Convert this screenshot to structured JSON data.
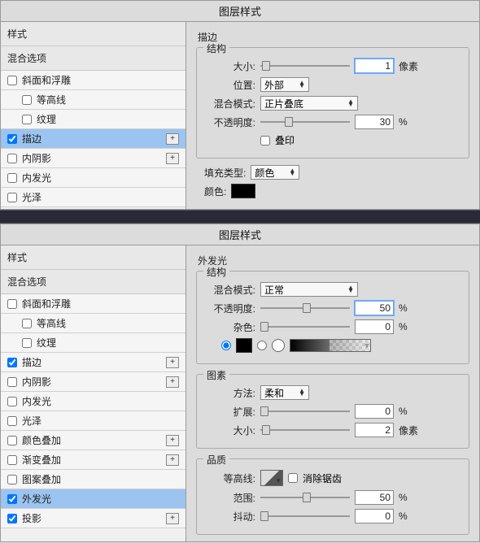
{
  "panel1": {
    "title": "图层样式",
    "sidebar": {
      "header1": "样式",
      "header2": "混合选项",
      "items": [
        {
          "label": "斜面和浮雕",
          "cb": false,
          "plus": false
        },
        {
          "label": "等高线",
          "cb": false,
          "plus": false,
          "indent": true
        },
        {
          "label": "纹理",
          "cb": false,
          "plus": false,
          "indent": true
        },
        {
          "label": "描边",
          "cb": true,
          "plus": true,
          "selected": true
        },
        {
          "label": "内阴影",
          "cb": false,
          "plus": true
        },
        {
          "label": "内发光",
          "cb": false,
          "plus": false
        },
        {
          "label": "光泽",
          "cb": false,
          "plus": false
        }
      ]
    },
    "content": {
      "sectionTitle": "描边",
      "structTitle": "结构",
      "sizeLabel": "大小:",
      "sizeValue": "1",
      "sizeUnit": "像素",
      "posLabel": "位置:",
      "posValue": "外部",
      "blendLabel": "混合模式:",
      "blendValue": "正片叠底",
      "opacityLabel": "不透明度:",
      "opacityValue": "30",
      "opacityUnit": "%",
      "overprintLabel": "叠印",
      "fillTypeLabel": "填充类型:",
      "fillTypeValue": "颜色",
      "colorLabel": "颜色:"
    }
  },
  "panel2": {
    "title": "图层样式",
    "sidebar": {
      "header1": "样式",
      "header2": "混合选项",
      "items": [
        {
          "label": "斜面和浮雕",
          "cb": false,
          "plus": false
        },
        {
          "label": "等高线",
          "cb": false,
          "plus": false,
          "indent": true
        },
        {
          "label": "纹理",
          "cb": false,
          "plus": false,
          "indent": true
        },
        {
          "label": "描边",
          "cb": true,
          "plus": true
        },
        {
          "label": "内阴影",
          "cb": false,
          "plus": true
        },
        {
          "label": "内发光",
          "cb": false,
          "plus": false
        },
        {
          "label": "光泽",
          "cb": false,
          "plus": false
        },
        {
          "label": "颜色叠加",
          "cb": false,
          "plus": true
        },
        {
          "label": "渐变叠加",
          "cb": false,
          "plus": true
        },
        {
          "label": "图案叠加",
          "cb": false,
          "plus": false
        },
        {
          "label": "外发光",
          "cb": true,
          "plus": false,
          "selected": true
        },
        {
          "label": "投影",
          "cb": true,
          "plus": true
        }
      ]
    },
    "content": {
      "sectionTitle": "外发光",
      "structTitle": "结构",
      "blendLabel": "混合模式:",
      "blendValue": "正常",
      "opacityLabel": "不透明度:",
      "opacityValue": "50",
      "opacityUnit": "%",
      "noiseLabel": "杂色:",
      "noiseValue": "0",
      "noiseUnit": "%",
      "elementTitle": "图素",
      "methodLabel": "方法:",
      "methodValue": "柔和",
      "spreadLabel": "扩展:",
      "spreadValue": "0",
      "spreadUnit": "%",
      "sizeLabel": "大小:",
      "sizeValue": "2",
      "sizeUnit": "像素",
      "qualityTitle": "品质",
      "contourLabel": "等高线:",
      "antialiasLabel": "消除锯齿",
      "rangeLabel": "范围:",
      "rangeValue": "50",
      "rangeUnit": "%",
      "jitterLabel": "抖动:",
      "jitterValue": "0",
      "jitterUnit": "%"
    }
  }
}
